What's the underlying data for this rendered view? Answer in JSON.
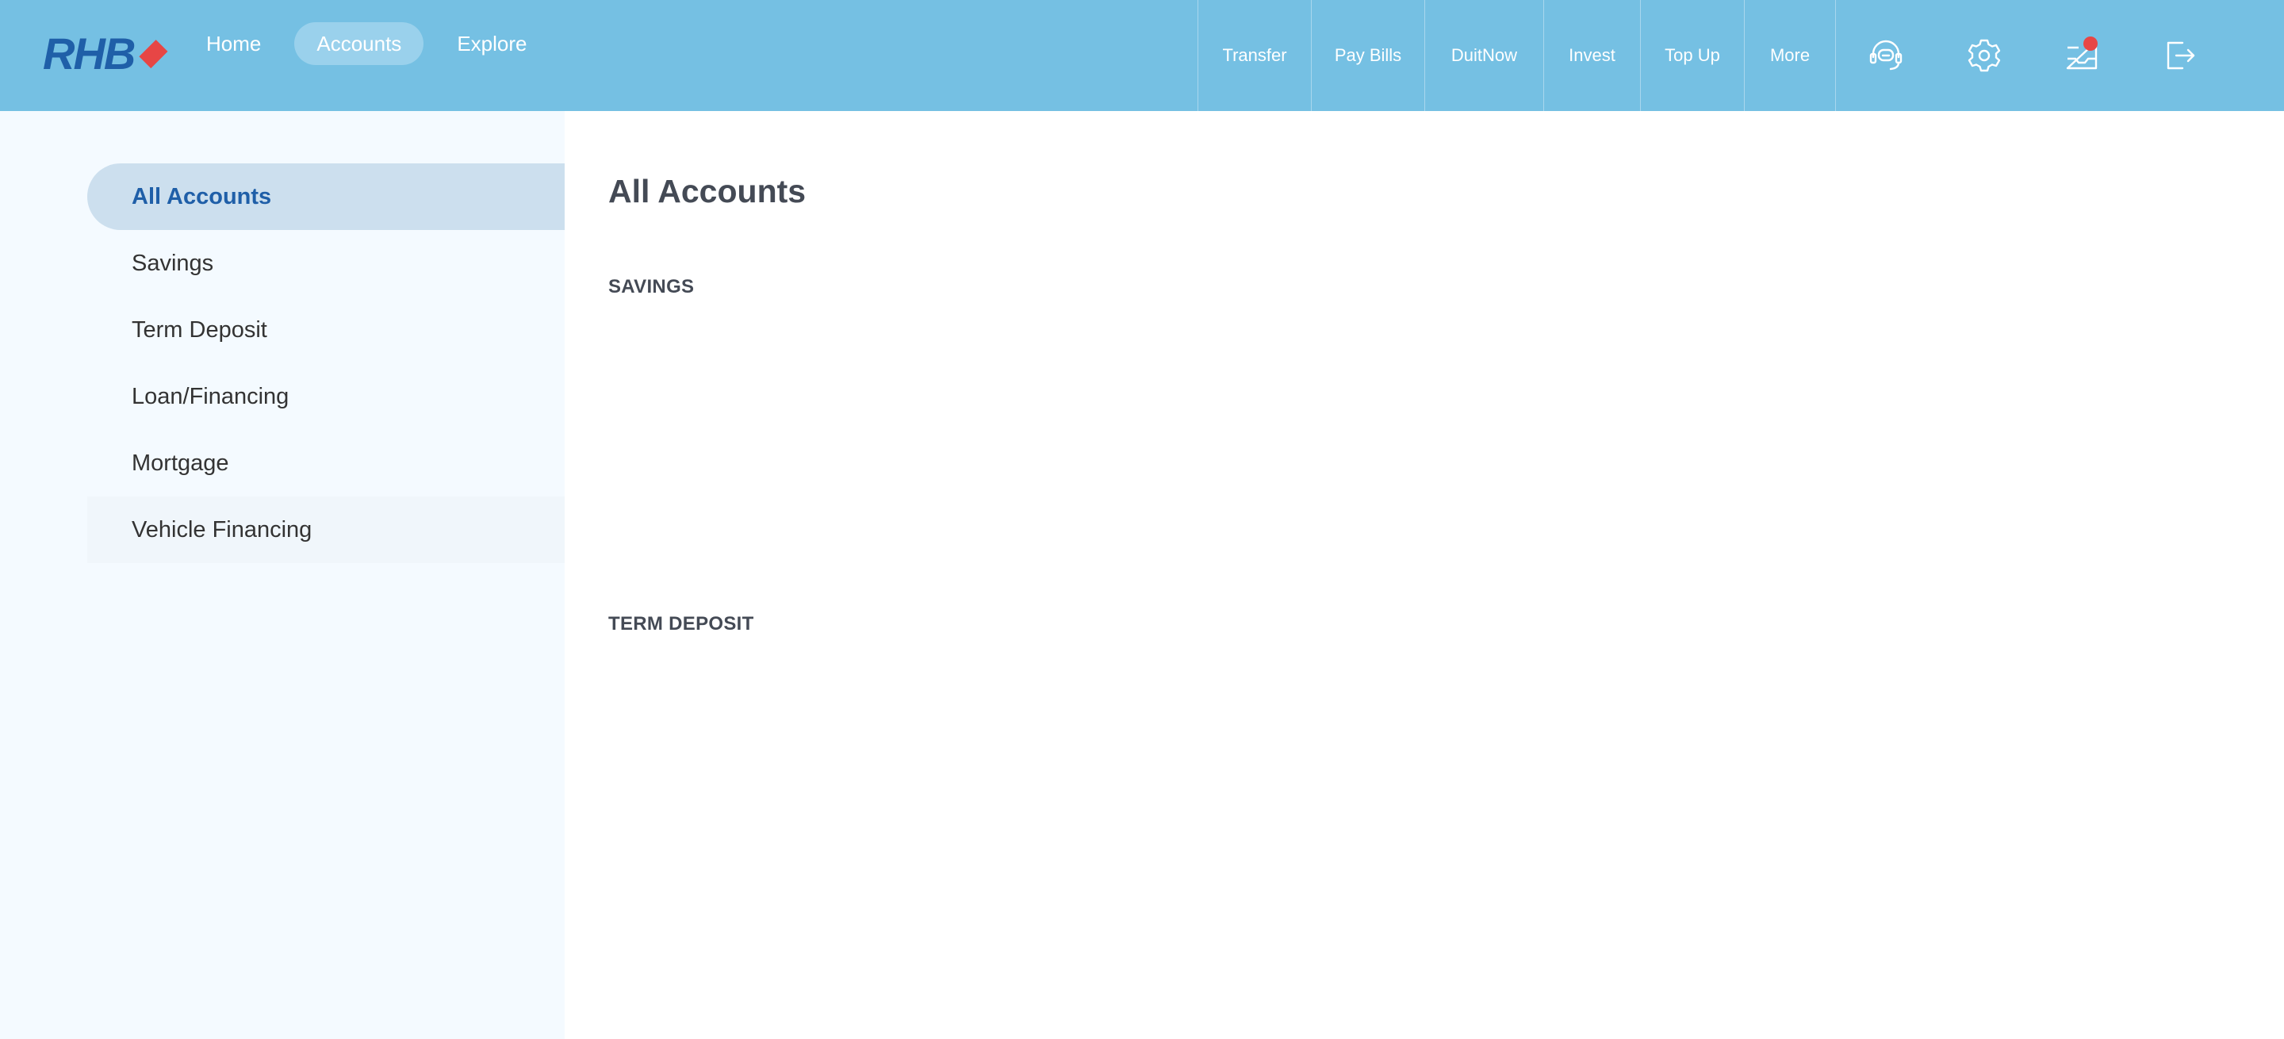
{
  "header": {
    "logo_text": "RHB",
    "nav": [
      {
        "label": "Home"
      },
      {
        "label": "Accounts"
      },
      {
        "label": "Explore"
      }
    ],
    "actions": [
      {
        "label": "Transfer"
      },
      {
        "label": "Pay Bills"
      },
      {
        "label": "DuitNow"
      },
      {
        "label": "Invest"
      },
      {
        "label": "Top Up"
      },
      {
        "label": "More"
      }
    ],
    "icons": [
      "support-icon",
      "settings-icon",
      "inbox-icon",
      "logout-icon"
    ],
    "brand_color": "#1f5fa8",
    "accent_color": "#e74645",
    "bar_color": "#75c0e3"
  },
  "sidebar": {
    "items": [
      {
        "label": "All Accounts"
      },
      {
        "label": "Savings"
      },
      {
        "label": "Term Deposit"
      },
      {
        "label": "Loan/Financing"
      },
      {
        "label": "Mortgage"
      },
      {
        "label": "Vehicle Financing"
      }
    ]
  },
  "main": {
    "title": "All Accounts",
    "sections": [
      {
        "title": "SAVINGS"
      },
      {
        "title": "TERM DEPOSIT"
      }
    ]
  }
}
